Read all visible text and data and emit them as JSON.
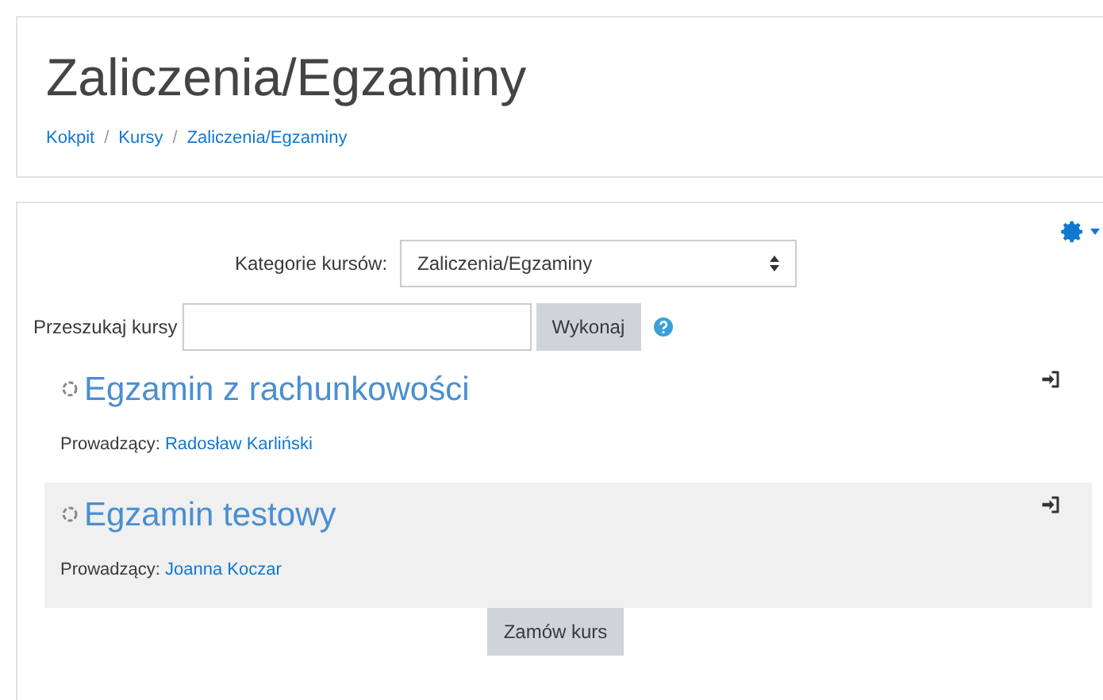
{
  "header": {
    "title": "Zaliczenia/Egzaminy",
    "breadcrumb": [
      "Kokpit",
      "Kursy",
      "Zaliczenia/Egzaminy"
    ],
    "separator": "/"
  },
  "category": {
    "label": "Kategorie kursów:",
    "value": "Zaliczenia/Egzaminy"
  },
  "search": {
    "label": "Przeszukaj kursy",
    "button": "Wykonaj"
  },
  "courses": [
    {
      "title": "Egzamin z rachunkowości",
      "teacher_label": "Prowadzący:",
      "teacher": "Radosław Karliński"
    },
    {
      "title": "Egzamin testowy",
      "teacher_label": "Prowadzący:",
      "teacher": "Joanna Koczar"
    }
  ],
  "order_button": "Zamów kurs"
}
